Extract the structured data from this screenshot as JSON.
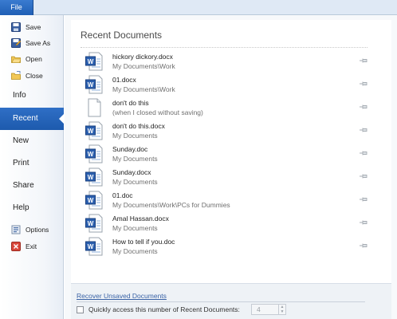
{
  "ribbon": {
    "file_tab": "File"
  },
  "sidebar": {
    "commands": [
      {
        "label": "Save",
        "icon": "save-icon"
      },
      {
        "label": "Save As",
        "icon": "save-as-icon"
      },
      {
        "label": "Open",
        "icon": "open-folder-icon"
      },
      {
        "label": "Close",
        "icon": "close-folder-icon"
      }
    ],
    "nav": [
      "Info",
      "Recent",
      "New",
      "Print",
      "Share",
      "Help"
    ],
    "options_label": "Options",
    "exit_label": "Exit",
    "selected": "Recent"
  },
  "recent": {
    "title": "Recent Documents",
    "documents": [
      {
        "name": "hickory dickory.docx",
        "path": "My Documents\\Work",
        "icon": "word-document-icon"
      },
      {
        "name": "01.docx",
        "path": "My Documents\\Work",
        "icon": "word-document-icon"
      },
      {
        "name": "don't do this",
        "path": "(when I closed without saving)",
        "icon": "blank-document-icon"
      },
      {
        "name": "don't do this.docx",
        "path": "My Documents",
        "icon": "word-document-icon"
      },
      {
        "name": "Sunday.doc",
        "path": "My Documents",
        "icon": "word-document-icon"
      },
      {
        "name": "Sunday.docx",
        "path": "My Documents",
        "icon": "word-document-icon"
      },
      {
        "name": "01.doc",
        "path": "My Documents\\Work\\PCs for Dummies",
        "icon": "word-document-icon"
      },
      {
        "name": "Amal Hassan.docx",
        "path": "My Documents",
        "icon": "word-document-icon"
      },
      {
        "name": "How to tell if you.doc",
        "path": "My Documents",
        "icon": "word-document-icon"
      }
    ]
  },
  "footer": {
    "recover_link": "Recover Unsaved Documents",
    "quick_access_label": "Quickly access this number of Recent Documents:",
    "quick_access_value": "4",
    "quick_access_checked": false
  },
  "colors": {
    "accent": "#1f5fb5",
    "link": "#3a63a6"
  }
}
